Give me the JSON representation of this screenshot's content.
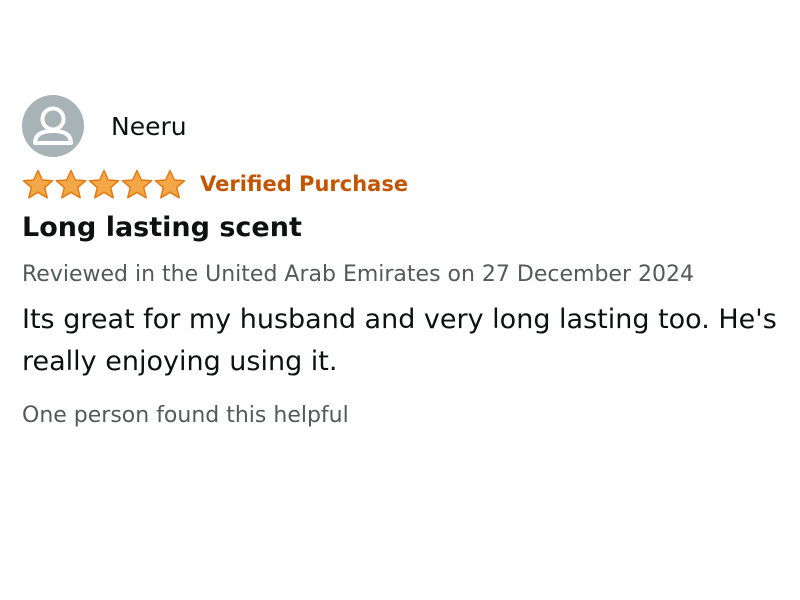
{
  "reviewer": {
    "name": "Neeru",
    "avatar_icon": "default-user-avatar-icon"
  },
  "rating": {
    "stars": 5,
    "max": 5,
    "star_color": "#f3a847",
    "star_stroke": "#e47911"
  },
  "badge": {
    "verified_label": "Verified Purchase",
    "color": "#c45500"
  },
  "review": {
    "title": "Long lasting scent",
    "meta": "Reviewed in the United Arab Emirates on 27 December 2024",
    "body": "Its great for my husband and very long lasting too. He's really enjoying using it.",
    "helpful_text": "One person found this helpful"
  }
}
